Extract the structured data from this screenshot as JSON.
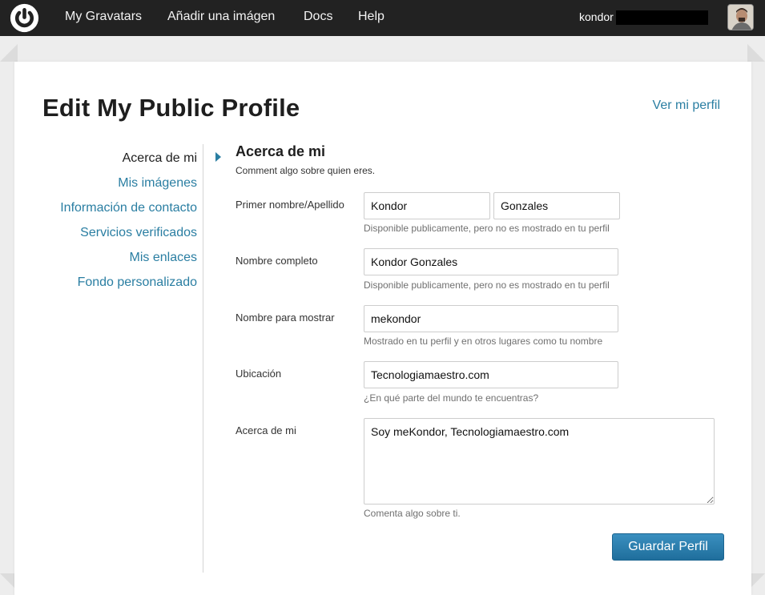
{
  "nav": {
    "items": [
      "My Gravatars",
      "Añadir una imágen",
      "Docs",
      "Help"
    ],
    "user": "kondor"
  },
  "page": {
    "title": "Edit My Public Profile",
    "view_profile": "Ver mi perfil"
  },
  "sidebar": {
    "items": [
      "Acerca de mi",
      "Mis imágenes",
      "Información de contacto",
      "Servicios verificados",
      "Mis enlaces",
      "Fondo personalizado"
    ],
    "active_index": 0
  },
  "form": {
    "section_title": "Acerca de mi",
    "section_subtitle": "Comment algo sobre quien eres.",
    "first_last": {
      "label": "Primer nombre/Apellido",
      "first": "Kondor",
      "last": "Gonzales",
      "hint": "Disponible publicamente, pero no es mostrado en tu perfil"
    },
    "full_name": {
      "label": "Nombre completo",
      "value": "Kondor Gonzales",
      "hint": "Disponible publicamente, pero no es mostrado en tu perfil"
    },
    "display_name": {
      "label": "Nombre para mostrar",
      "value": "mekondor",
      "hint": "Mostrado en tu perfil y en otros lugares como tu nombre"
    },
    "location": {
      "label": "Ubicación",
      "value": "Tecnologiamaestro.com",
      "hint": "¿En qué parte del mundo te encuentras?"
    },
    "about": {
      "label": "Acerca de mi",
      "value": "Soy meKondor, Tecnologiamaestro.com",
      "hint": "Comenta algo sobre ti."
    },
    "save_label": "Guardar Perfil"
  },
  "colors": {
    "topbar": "#222222",
    "link": "#2a7ea2",
    "button": "#2a7ea2"
  }
}
